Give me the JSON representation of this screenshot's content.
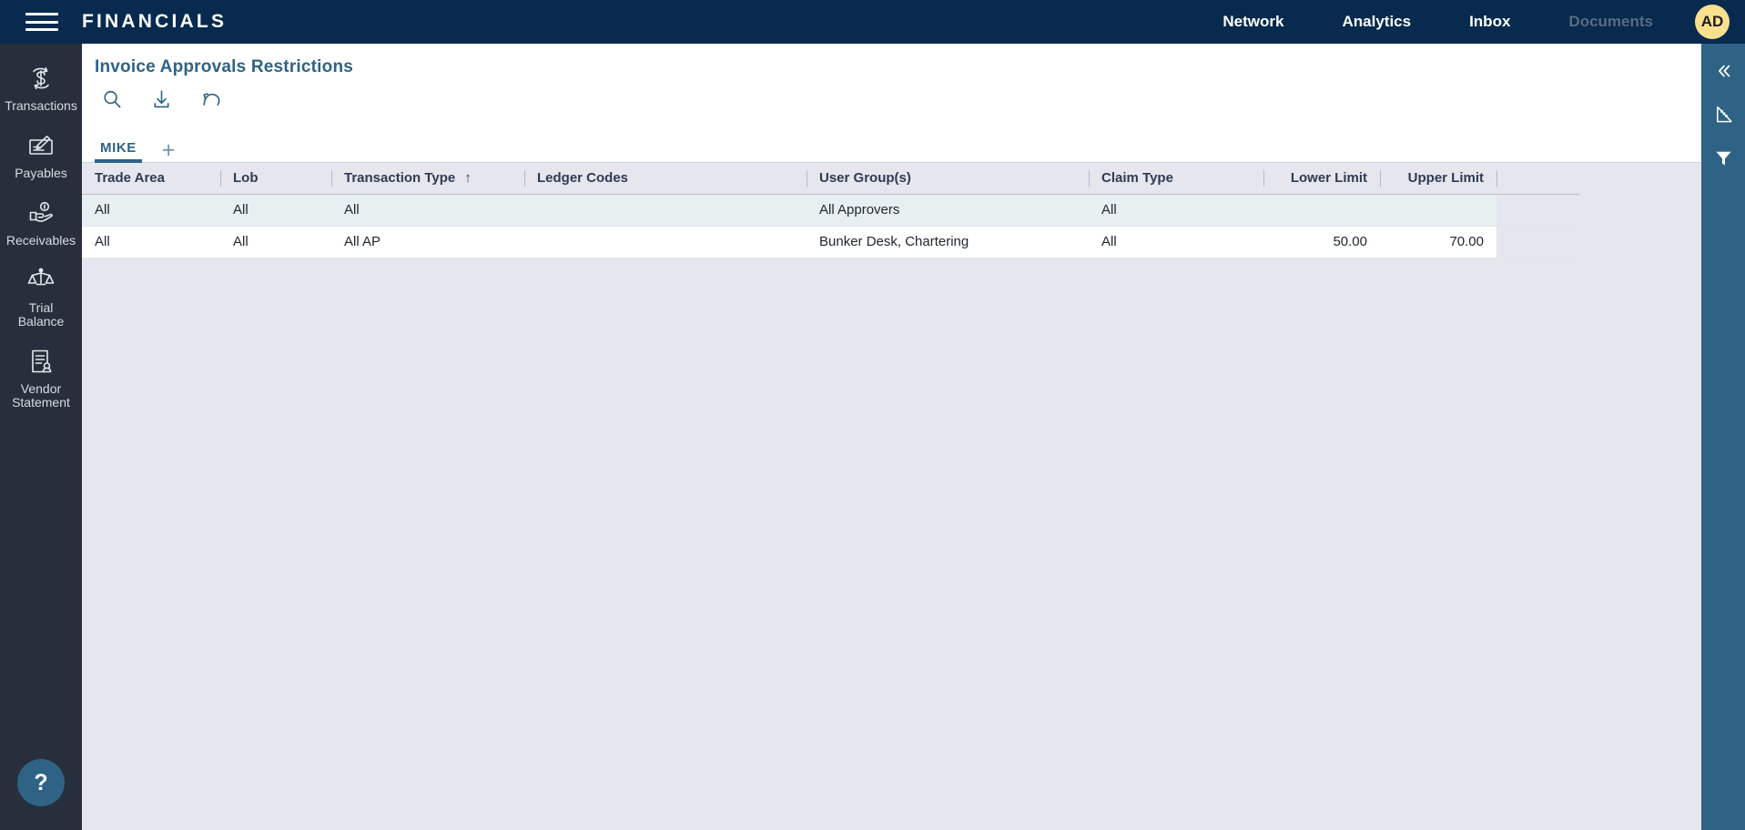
{
  "topbar": {
    "menu_icon": "hamburger-icon",
    "brand": "FINANCIALS",
    "nav": [
      {
        "label": "Network",
        "disabled": false
      },
      {
        "label": "Analytics",
        "disabled": false
      },
      {
        "label": "Inbox",
        "disabled": false
      },
      {
        "label": "Documents",
        "disabled": true
      }
    ],
    "avatar_initials": "AD",
    "avatar_color": "#f8e08e",
    "background_color": "#072a4e"
  },
  "sidebar": {
    "background_color": "#262f3b",
    "items": [
      {
        "label": "Transactions",
        "icon": "transactions-dollar-icon"
      },
      {
        "label": "Payables",
        "icon": "check-pen-icon"
      },
      {
        "label": "Receivables",
        "icon": "hand-coin-icon"
      },
      {
        "label": "Trial\nBalance",
        "icon": "scales-balance-icon"
      },
      {
        "label": "Vendor\nStatement",
        "icon": "document-person-icon"
      }
    ],
    "help_label": "?"
  },
  "right_rail": {
    "background_color": "#2e6385",
    "items": [
      {
        "icon": "collapse-double-chevron-left-icon",
        "glyph": "«"
      },
      {
        "icon": "ruler-triangle-icon"
      },
      {
        "icon": "filter-funnel-icon"
      }
    ]
  },
  "page": {
    "title": "Invoice Approvals Restrictions",
    "title_color": "#2e6385",
    "toolbar": [
      {
        "icon": "search-icon",
        "name": "search-button"
      },
      {
        "icon": "download-icon",
        "name": "download-button"
      },
      {
        "icon": "undo-icon",
        "name": "reset-button"
      }
    ],
    "tabs": [
      {
        "label": "MIKE",
        "active": true
      }
    ],
    "add_tab_label": "+"
  },
  "table": {
    "columns": [
      {
        "label": "Trade Area",
        "align": "left",
        "sorted": false
      },
      {
        "label": "Lob",
        "align": "left",
        "sorted": false
      },
      {
        "label": "Transaction Type",
        "align": "left",
        "sorted": true,
        "sort_dir": "↑"
      },
      {
        "label": "Ledger Codes",
        "align": "left",
        "sorted": false
      },
      {
        "label": "User Group(s)",
        "align": "left",
        "sorted": false
      },
      {
        "label": "Claim Type",
        "align": "left",
        "sorted": false
      },
      {
        "label": "Lower Limit",
        "align": "right",
        "sorted": false
      },
      {
        "label": "Upper Limit",
        "align": "right",
        "sorted": false
      },
      {
        "label": "",
        "align": "left",
        "sorted": false
      }
    ],
    "rows": [
      {
        "trade_area": "All",
        "lob": "All",
        "transaction_type": "All",
        "ledger_codes": "",
        "user_groups": "All Approvers",
        "claim_type": "All",
        "lower_limit": "",
        "upper_limit": "",
        "trailing": ""
      },
      {
        "trade_area": "All",
        "lob": "All",
        "transaction_type": "All AP",
        "ledger_codes": "",
        "user_groups": "Bunker Desk, Chartering",
        "claim_type": "All",
        "lower_limit": "50.00",
        "upper_limit": "70.00",
        "trailing": ""
      }
    ]
  }
}
